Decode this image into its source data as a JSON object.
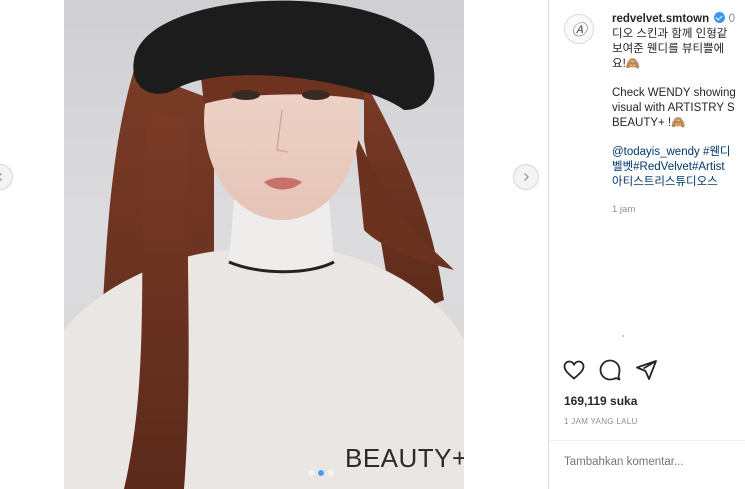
{
  "post": {
    "image_watermark": "BEAUTY+",
    "carousel": {
      "count": 3,
      "active_index": 1
    }
  },
  "author": {
    "avatar_letter": "Ⓐ",
    "username": "redvelvet.smtown",
    "header_suffix": "0"
  },
  "caption": {
    "korean_lines": [
      "디오 스킨과 함께 인형같",
      "보여준 웬디를 뷰티쁠에",
      "요!🙈"
    ],
    "english_lines": [
      "Check WENDY showing",
      "visual with ARTISTRY S",
      "BEAUTY+ !🙈"
    ],
    "tag_lines": [
      "@todayis_wendy #웬디",
      "벨벳#RedVelvet#Artist",
      "아티스트리스튜디오스"
    ],
    "time_ago": "1 jam"
  },
  "actions": {
    "like_icon": "heart-icon",
    "comment_icon": "comment-icon",
    "share_icon": "paper-plane-icon"
  },
  "likes_text": "169,119 suka",
  "posted_ago": "1 JAM YANG LALU",
  "comment_placeholder": "Tambahkan komentar...",
  "colors": {
    "verified": "#3897f0",
    "link": "#00376b",
    "muted": "#8e8e8e",
    "active_dot": "#4a9ff5"
  }
}
